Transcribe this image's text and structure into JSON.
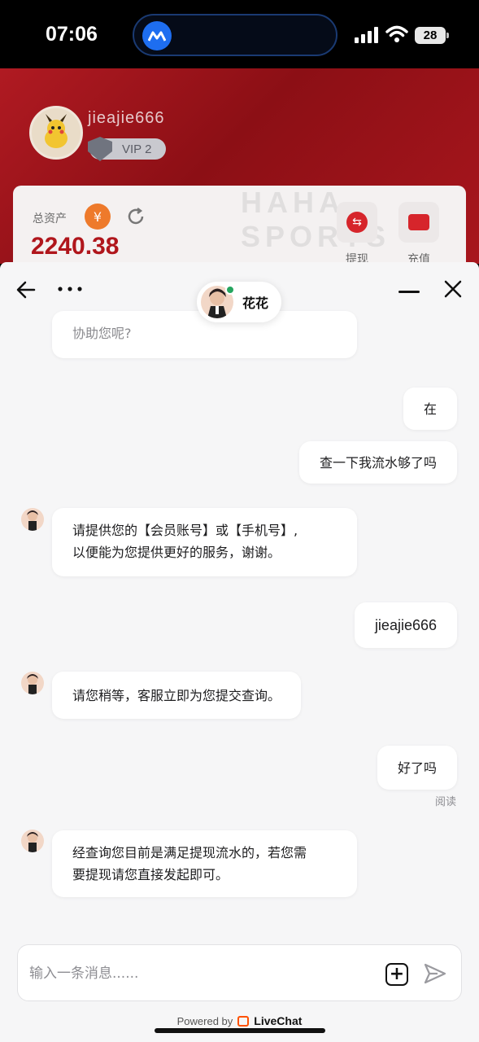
{
  "status_bar": {
    "time": "07:06",
    "battery": "28"
  },
  "app": {
    "username": "jieajie666",
    "vip_label": "VIP 2",
    "asset_label": "总资产",
    "currency_symbol": "¥",
    "asset_value": "2240.38",
    "watermark": "HAHA SPORTS",
    "actions": [
      {
        "label": "提现",
        "icon": "withdraw-icon"
      },
      {
        "label": "充值",
        "icon": "card-icon"
      }
    ]
  },
  "chat": {
    "agent_name": "花花",
    "messages": [
      {
        "from": "agent",
        "text": "协助您呢?"
      },
      {
        "from": "visitor",
        "text": "在"
      },
      {
        "from": "visitor",
        "text": "查一下我流水够了吗"
      },
      {
        "from": "agent",
        "lines": [
          "请提供您的【会员账号】或【手机号】,",
          "以便能为您提供更好的服务，谢谢。"
        ]
      },
      {
        "from": "visitor",
        "text": "jieajie666"
      },
      {
        "from": "agent",
        "text": "请您稍等，客服立即为您提交查询。"
      },
      {
        "from": "visitor",
        "text": "好了吗",
        "status": "阅读"
      },
      {
        "from": "agent",
        "lines": [
          "经查询您目前是满足提现流水的，若您需",
          "要提现请您直接发起即可。"
        ]
      }
    ],
    "composer_placeholder": "输入一条消息......",
    "powered_by": "Powered by",
    "brand": "LiveChat"
  },
  "colors": {
    "brand_red": "#b0161c",
    "online": "#25a55f",
    "livechat_orange": "#ff5100"
  }
}
